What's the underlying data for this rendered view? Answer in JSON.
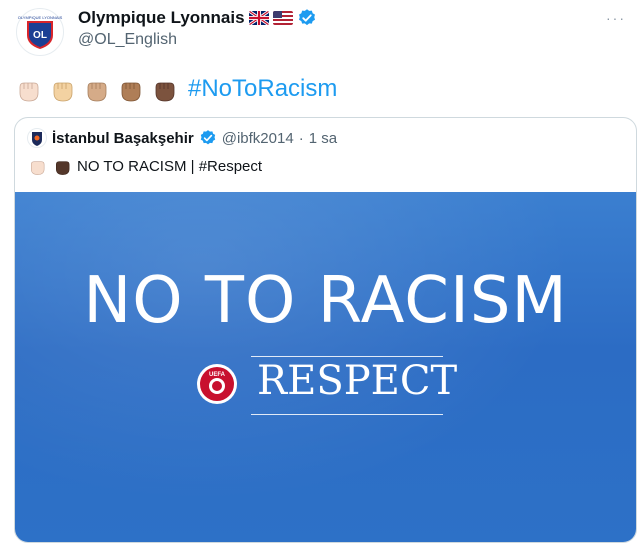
{
  "tweet": {
    "author_name": "Olympique Lyonnais",
    "handle": "@OL_English",
    "avatar_text": "OLYMPIQUE LYONNAIS",
    "avatar_monogram": "OL",
    "hashtag": "#NoToRacism",
    "more_label": "···"
  },
  "quote": {
    "author_name": "İstanbul Başakşehir",
    "handle": "@ibfk2014",
    "separator": "·",
    "time": "1 sa",
    "text": "NO TO RACISM | #Respect",
    "banner_headline": "NO TO RACISM",
    "banner_respect": "RESPECT",
    "banner_logo_text": "UEFA"
  },
  "colors": {
    "link": "#1d9bf0",
    "verified": "#1d9bf0",
    "banner": "#2c6cc4"
  },
  "skin_tones": [
    "#f7dece",
    "#f3d2a2",
    "#d5ab88",
    "#af7e57",
    "#7c533e"
  ]
}
